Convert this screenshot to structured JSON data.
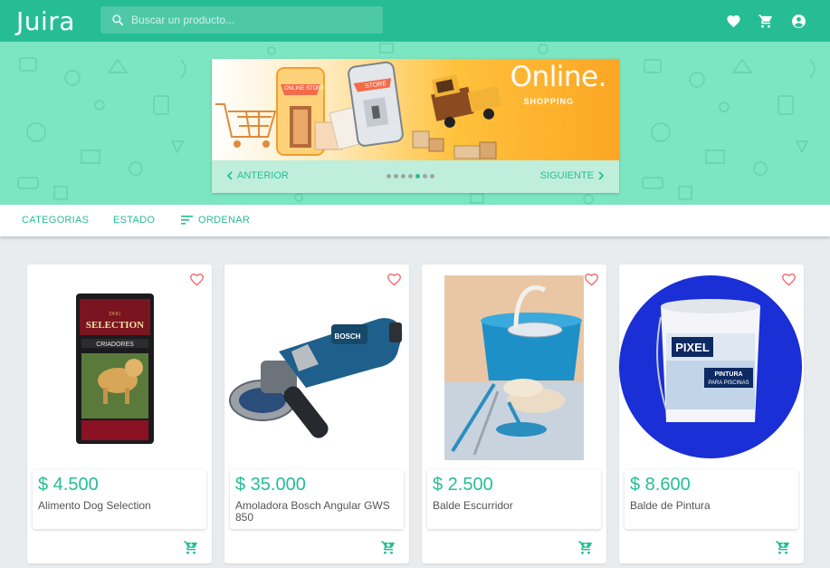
{
  "app": {
    "logo": "Juira"
  },
  "search": {
    "placeholder": "Buscar un producto..."
  },
  "hero": {
    "banner_title": "Online.",
    "banner_subtitle": "SHOPPING",
    "shop_sign_1": "ONLINE STORE",
    "shop_sign_2": "STORE",
    "prev_label": "ANTERIOR",
    "next_label": "SIGUIENTE",
    "slide_count": 7,
    "active_slide": 5
  },
  "filters": {
    "categories_label": "CATEGORIAS",
    "state_label": "ESTADO",
    "sort_label": "ORDENAR"
  },
  "products": [
    {
      "price": "$ 4.500",
      "name": "Alimento Dog Selection",
      "image_labels": [
        "DOG",
        "SELECTION",
        "CRIADORES"
      ]
    },
    {
      "price": "$ 35.000",
      "name": "Amoladora Bosch Angular GWS 850",
      "image_labels": [
        "BOSCH"
      ]
    },
    {
      "price": "$ 2.500",
      "name": "Balde Escurridor",
      "image_labels": []
    },
    {
      "price": "$ 8.600",
      "name": "Balde de Pintura",
      "image_labels": [
        "PIXEL",
        "PINTURA",
        "PARA PISCINAS"
      ]
    }
  ],
  "colors": {
    "primary": "#26bd95",
    "hero_bg": "#7ce5c1",
    "heart": "#f06a6a",
    "page_bg": "#e9ecee"
  },
  "icons": {
    "search": "search-icon",
    "favorites": "heart-icon",
    "cart": "cart-icon",
    "account": "account-icon",
    "prev": "chevron-left-icon",
    "next": "chevron-right-icon",
    "sort": "sort-icon",
    "add_to_cart": "add-cart-icon"
  }
}
